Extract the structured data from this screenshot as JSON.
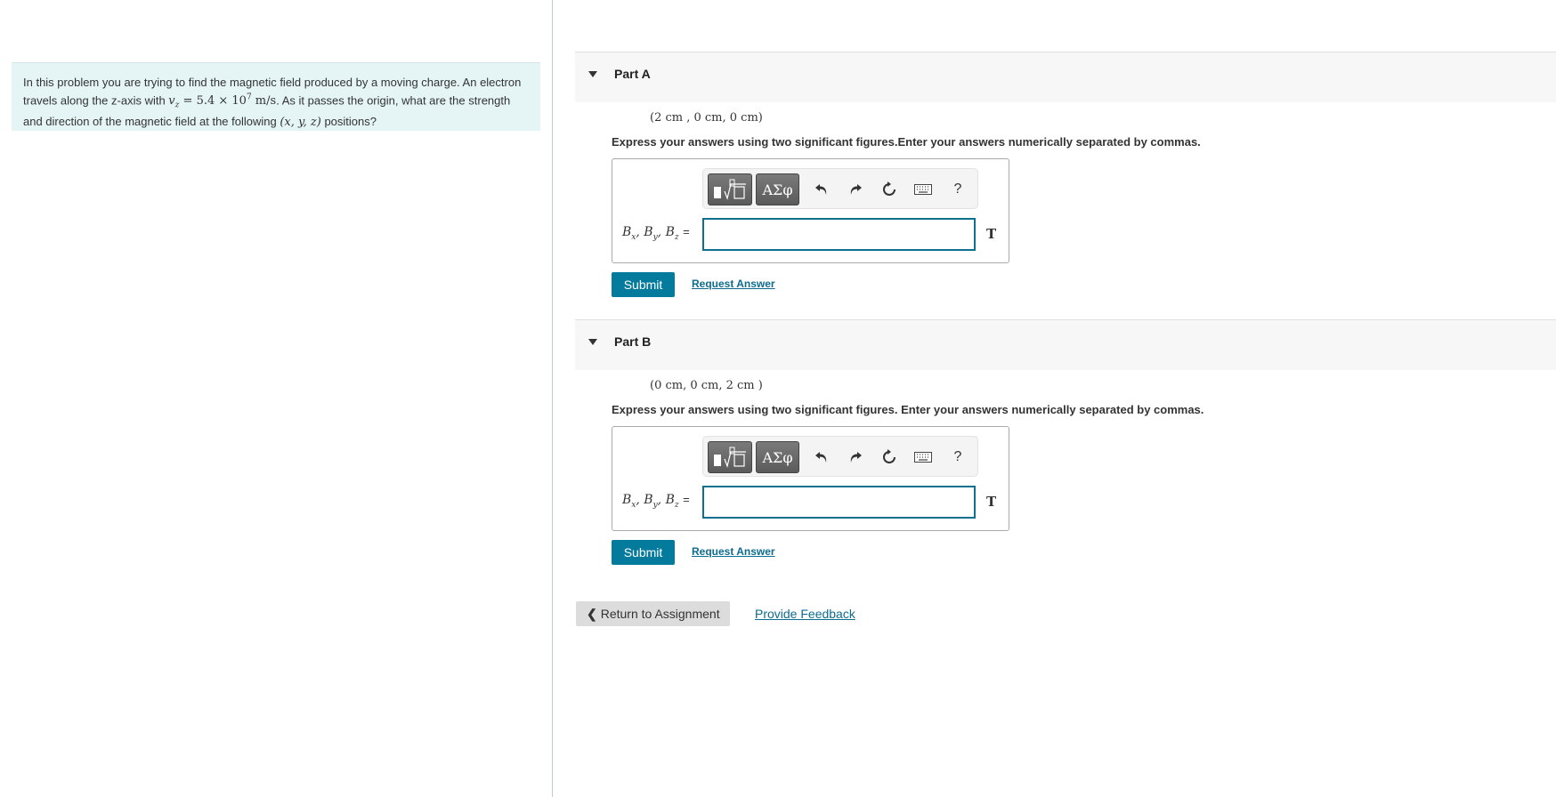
{
  "problem": {
    "text_1": "In this problem you are trying to find the magnetic field produced by a moving charge. An electron travels along the z-axis with ",
    "math_velocity": "v",
    "math_velocity_sub": "z",
    "math_value": " = 5.4 × 10",
    "math_exp": "7",
    "math_units": " m/s",
    "text_2": ". As it passes the origin, what are the strength and direction of the magnetic field at the following ",
    "math_coords": "(x, y, z)",
    "text_3": " positions?"
  },
  "toolbar": {
    "template_icon": "fraction-root-template-icon",
    "greek_label": "ΑΣφ",
    "undo_icon": "undo-icon",
    "redo_icon": "redo-icon",
    "reset_icon": "reset-icon",
    "keyboard_icon": "keyboard-icon",
    "help_label": "?"
  },
  "parts": [
    {
      "title": "Part A",
      "coords": "(2 cm , 0 cm, 0 cm)",
      "instructions": "Express your answers using two significant figures.Enter your answers numerically separated by commas.",
      "label": "B",
      "label_subs": [
        "x",
        "y",
        "z"
      ],
      "equals": "=",
      "input_value": "",
      "unit": "T",
      "submit_label": "Submit",
      "request_label": "Request Answer"
    },
    {
      "title": "Part B",
      "coords": "(0 cm, 0 cm, 2 cm )",
      "instructions": "Express your answers using two significant figures. Enter your answers numerically separated by commas.",
      "label": "B",
      "label_subs": [
        "x",
        "y",
        "z"
      ],
      "equals": "=",
      "input_value": "",
      "unit": "T",
      "submit_label": "Submit",
      "request_label": "Request Answer"
    }
  ],
  "footer": {
    "return_label": "Return to Assignment",
    "feedback_label": "Provide Feedback"
  },
  "colors": {
    "accent": "#047a9c",
    "link": "#0d6c8f",
    "problem_bg": "#e5f5f6",
    "input_border": "#0f6f8e"
  }
}
